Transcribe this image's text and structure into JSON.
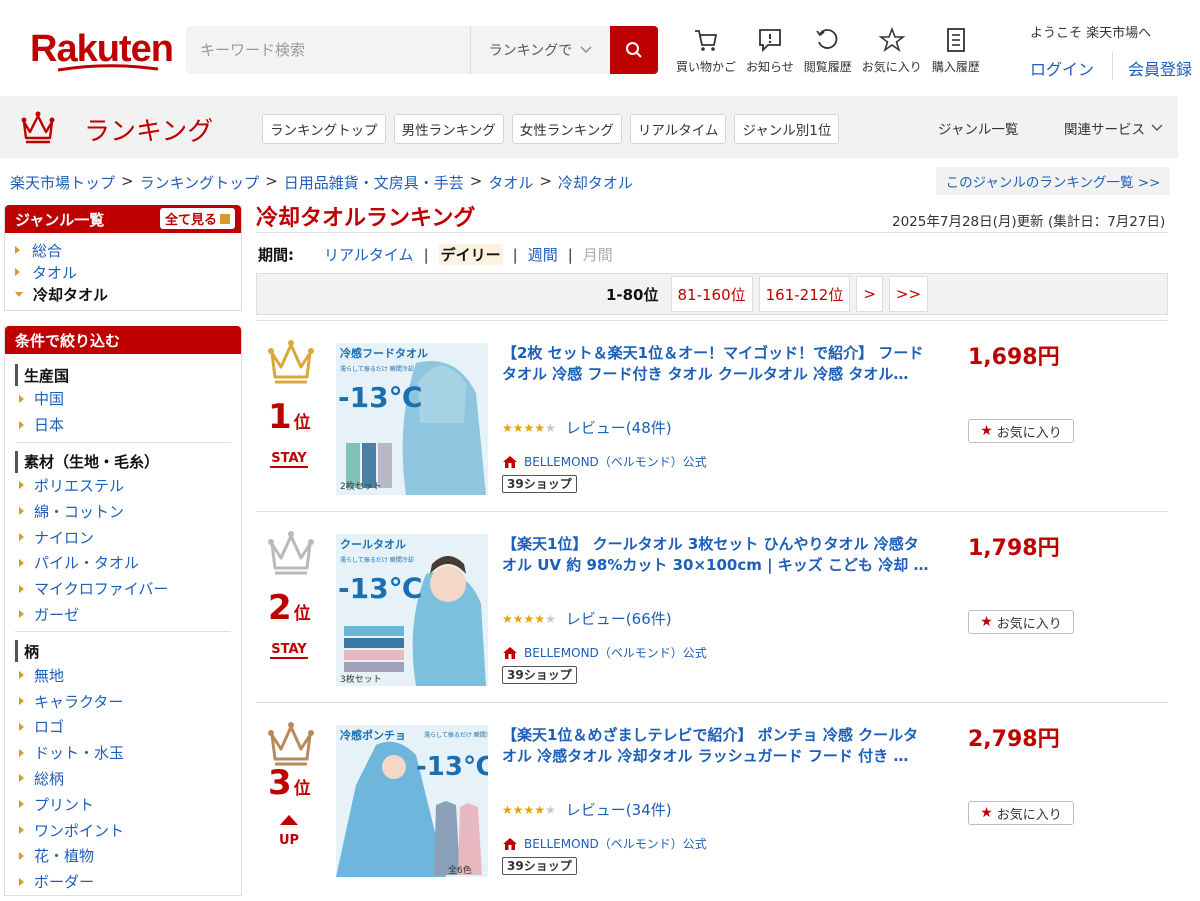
{
  "header": {
    "logo": "Rakuten",
    "search_placeholder": "キーワード検索",
    "search_scope": "ランキングで",
    "icons": [
      {
        "label": "買い物かご",
        "icon": "cart-icon"
      },
      {
        "label": "お知らせ",
        "icon": "notice-icon"
      },
      {
        "label": "閲覧履歴",
        "icon": "history-icon"
      },
      {
        "label": "お気に入り",
        "icon": "star-icon"
      },
      {
        "label": "購入履歴",
        "icon": "receipt-icon"
      }
    ],
    "welcome": "ようこそ 楽天市場へ",
    "login": "ログイン",
    "register": "会員登録"
  },
  "rankbar": {
    "title": "ランキング",
    "tabs": [
      "ランキングトップ",
      "男性ランキング",
      "女性ランキング",
      "リアルタイム",
      "ジャンル別1位"
    ],
    "genre_all": "ジャンル一覧",
    "related": "関連サービス"
  },
  "breadcrumb": [
    "楽天市場トップ",
    "ランキングトップ",
    "日用品雑貨・文房具・手芸",
    "タオル",
    "冷却タオル"
  ],
  "genre_ranking_link": "このジャンルのランキング一覧 >>",
  "sidebar": {
    "genre_title": "ジャンル一覧",
    "see_all": "全て見る",
    "genres": [
      {
        "label": "総合",
        "current": false
      },
      {
        "label": "タオル",
        "current": false
      },
      {
        "label": "冷却タオル",
        "current": true
      }
    ],
    "filter_title": "条件で絞り込む",
    "groups": [
      {
        "title": "生産国",
        "items": [
          "中国",
          "日本"
        ]
      },
      {
        "title": "素材（生地・毛糸）",
        "items": [
          "ポリエステル",
          "綿・コットン",
          "ナイロン",
          "パイル・タオル",
          "マイクロファイバー",
          "ガーゼ"
        ]
      },
      {
        "title": "柄",
        "items": [
          "無地",
          "キャラクター",
          "ロゴ",
          "ドット・水玉",
          "総柄",
          "プリント",
          "ワンポイント",
          "花・植物",
          "ボーダー"
        ]
      }
    ]
  },
  "main": {
    "title": "冷却タオルランキング",
    "update": "2025年7月28日(月)更新 (集計日：7月27日)",
    "period_label": "期間:",
    "periods": [
      {
        "label": "リアルタイム",
        "state": "link"
      },
      {
        "label": "デイリー",
        "state": "active"
      },
      {
        "label": "週間",
        "state": "link"
      },
      {
        "label": "月間",
        "state": "disabled"
      }
    ],
    "pager": {
      "current": "1-80位",
      "pages": [
        "81-160位",
        "161-212位",
        ">",
        ">>"
      ]
    }
  },
  "items": [
    {
      "rank": "1",
      "rank_unit": "位",
      "status": "STAY",
      "crown_color": "#d8a93a",
      "name": "【2枚 セット＆楽天1位＆オー！マイゴッド！で紹介】 フードタオル 冷感 フード付き タオル クールタオル 冷感 タオル…",
      "review": "レビュー(48件)",
      "rating": 4,
      "shop": "BELLEMOND（ベルモンド）公式",
      "badge": "39ショップ",
      "price": "1,698円",
      "fav": "お気に入り",
      "img_title": "冷感フードタオル",
      "img_sub": "濡らして振るだけ 瞬間冷却",
      "img_temp": "-13℃",
      "img_count": "2枚セット"
    },
    {
      "rank": "2",
      "rank_unit": "位",
      "status": "STAY",
      "crown_color": "#b9b9b9",
      "name": "【楽天1位】 クールタオル 3枚セット ひんやりタオル 冷感タオル UV 約 98%カット 30×100cm | キッズ こども 冷却 …",
      "review": "レビュー(66件)",
      "rating": 4,
      "shop": "BELLEMOND（ベルモンド）公式",
      "badge": "39ショップ",
      "price": "1,798円",
      "fav": "お気に入り",
      "img_title": "クールタオル",
      "img_sub": "濡らして振るだけ 瞬間冷却",
      "img_temp": "-13℃",
      "img_count": "3枚セット"
    },
    {
      "rank": "3",
      "rank_unit": "位",
      "status": "UP",
      "crown_color": "#b78a5a",
      "name": "【楽天1位＆めざましテレビで紹介】 ポンチョ 冷感 クールタオル 冷感タオル 冷却タオル ラッシュガード フード 付き …",
      "review": "レビュー(34件)",
      "rating": 4,
      "shop": "BELLEMOND（ベルモンド）公式",
      "badge": "39ショップ",
      "price": "2,798円",
      "fav": "お気に入り",
      "img_title": "冷感ポンチョ",
      "img_sub": "濡らして振るだけ 瞬間冷却",
      "img_temp": "-13℃",
      "img_count": "全6色"
    }
  ]
}
